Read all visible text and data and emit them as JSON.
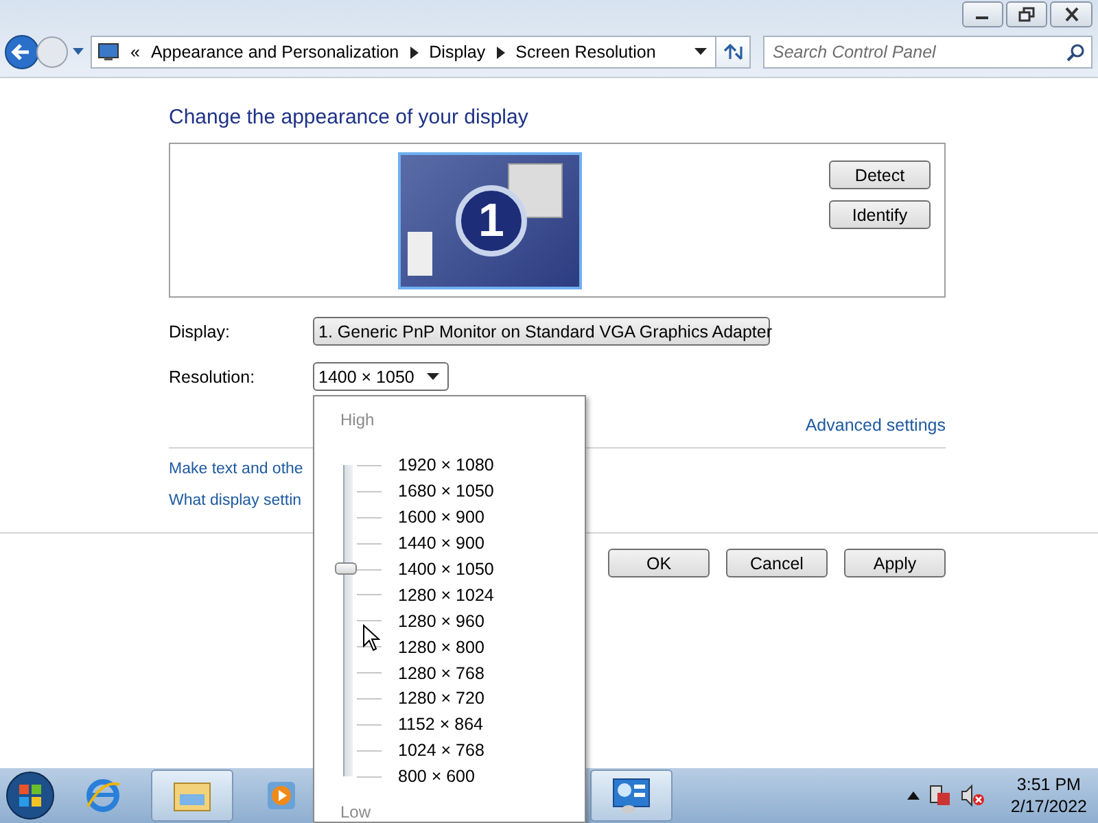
{
  "address_bar": {
    "overflow": "«",
    "crumbs": [
      "Appearance and Personalization",
      "Display",
      "Screen Resolution"
    ]
  },
  "search": {
    "placeholder": "Search Control Panel"
  },
  "heading": "Change the appearance of your display",
  "monitor": {
    "number": "1",
    "buttons": [
      "Detect",
      "Identify"
    ]
  },
  "display_field": {
    "label": "Display:",
    "value": "1. Generic PnP Monitor on Standard VGA Graphics Adapter"
  },
  "resolution_field": {
    "label": "Resolution:",
    "value": "1400 × 1050",
    "expanded": true
  },
  "advanced_link": "Advanced settings",
  "links": [
    "Make text and othe",
    "What display settin"
  ],
  "dialog_buttons": [
    "OK",
    "Cancel",
    "Apply"
  ],
  "resolution_popup": {
    "high_label": "High",
    "low_label": "Low",
    "level": 0.667,
    "options": [
      "1920 × 1080",
      "1680 × 1050",
      "1600 × 900",
      "1440 × 900",
      "1400 × 1050",
      "1280 × 1024",
      "1280 × 960",
      "1280 × 800",
      "1280 × 768",
      "1280 × 720",
      "1152 × 864",
      "1024 × 768",
      "800 × 600"
    ]
  },
  "taskbar": {
    "apps": [
      {
        "kind": "ie",
        "active": false
      },
      {
        "kind": "explorer",
        "active": true
      },
      {
        "kind": "media",
        "active": false
      },
      {
        "kind": "control",
        "active": true
      }
    ],
    "time": "3:51 PM",
    "date": "2/17/2022"
  }
}
